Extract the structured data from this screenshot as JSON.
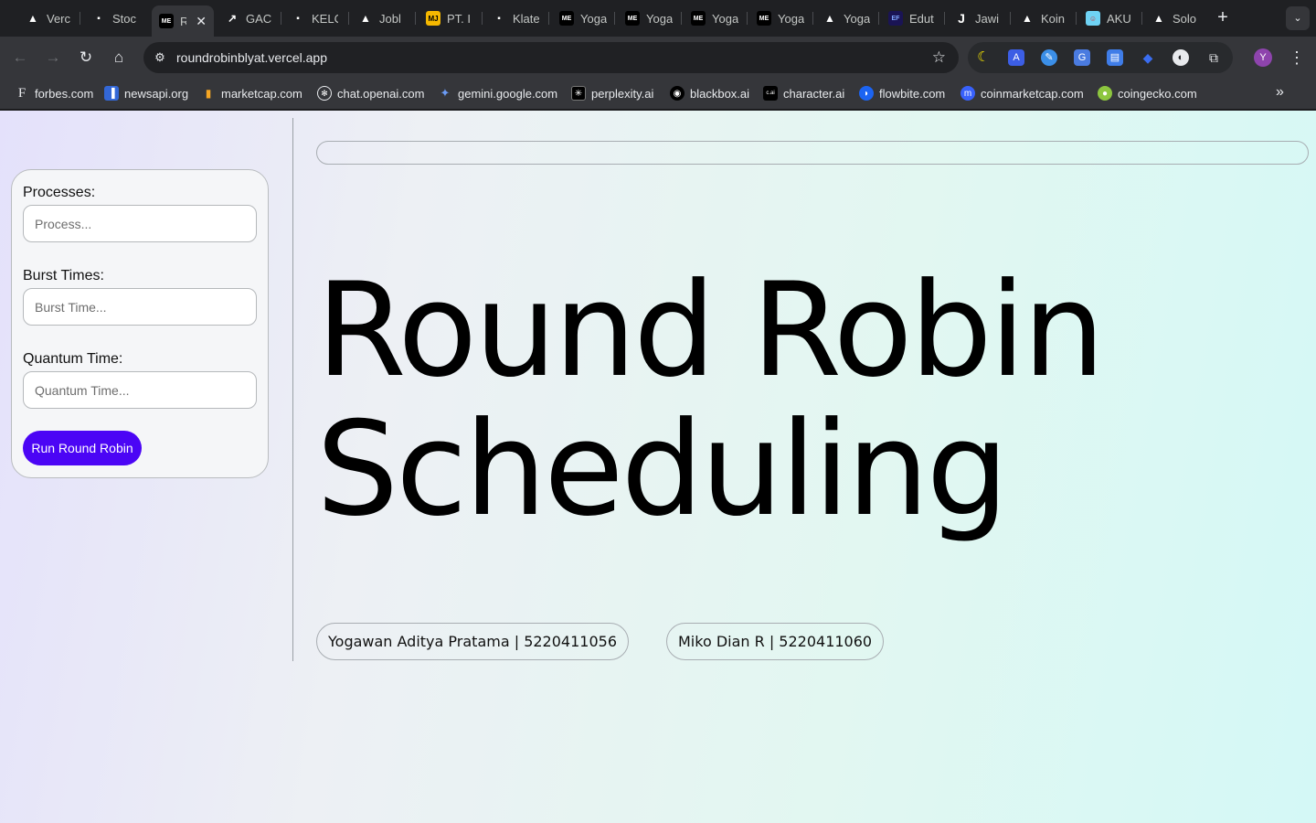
{
  "browser": {
    "tabs": [
      {
        "label": "Verc",
        "icon": "vercel-triangle-icon"
      },
      {
        "label": "Stoc",
        "icon": "dots-icon"
      },
      {
        "label": "R",
        "icon": "medium-icon",
        "active": true
      },
      {
        "label": "GAC",
        "icon": "arrow-icon"
      },
      {
        "label": "KELC",
        "icon": "dots-icon"
      },
      {
        "label": "Jobl",
        "icon": "vercel-triangle-icon"
      },
      {
        "label": "PT. I",
        "icon": "mj-icon"
      },
      {
        "label": "Klate",
        "icon": "dots-icon"
      },
      {
        "label": "Yoga",
        "icon": "medium-icon"
      },
      {
        "label": "Yoga",
        "icon": "medium-icon"
      },
      {
        "label": "Yoga",
        "icon": "medium-icon"
      },
      {
        "label": "Yoga",
        "icon": "medium-icon"
      },
      {
        "label": "Yoga",
        "icon": "vercel-triangle-icon"
      },
      {
        "label": "Edut",
        "icon": "ef-icon"
      },
      {
        "label": "Jawi",
        "icon": "j-icon"
      },
      {
        "label": "Koin",
        "icon": "vercel-triangle-icon"
      },
      {
        "label": "AKU",
        "icon": "aku-icon"
      },
      {
        "label": "Solo",
        "icon": "vercel-triangle-icon"
      }
    ],
    "new_tab": "+",
    "url": "roundrobinblyat.vercel.app",
    "profile_initial": "Y",
    "bookmarks": [
      {
        "label": "forbes.com",
        "icon": "forbes-icon"
      },
      {
        "label": "newsapi.org",
        "icon": "newsapi-icon"
      },
      {
        "label": "marketcap.com",
        "icon": "bars-icon"
      },
      {
        "label": "chat.openai.com",
        "icon": "openai-icon"
      },
      {
        "label": "gemini.google.com",
        "icon": "gemini-icon"
      },
      {
        "label": "perplexity.ai",
        "icon": "perplexity-icon"
      },
      {
        "label": "blackbox.ai",
        "icon": "blackbox-icon"
      },
      {
        "label": "character.ai",
        "icon": "characterai-icon"
      },
      {
        "label": "flowbite.com",
        "icon": "flowbite-icon"
      },
      {
        "label": "coinmarketcap.com",
        "icon": "coinmarketcap-icon"
      },
      {
        "label": "coingecko.com",
        "icon": "coingecko-icon"
      }
    ]
  },
  "form": {
    "processes_label": "Processes:",
    "processes_placeholder": "Process...",
    "burst_label": "Burst Times:",
    "burst_placeholder": "Burst Time...",
    "quantum_label": "Quantum Time:",
    "quantum_placeholder": "Quantum Time...",
    "run_label": "Run Round Robin",
    "run_color": "#4b05f5"
  },
  "main": {
    "title_line1": "Round Robin",
    "title_line2": "Scheduling",
    "credits": [
      "Yogawan Aditya Pratama | 5220411056",
      "Miko Dian R | 5220411060"
    ]
  }
}
